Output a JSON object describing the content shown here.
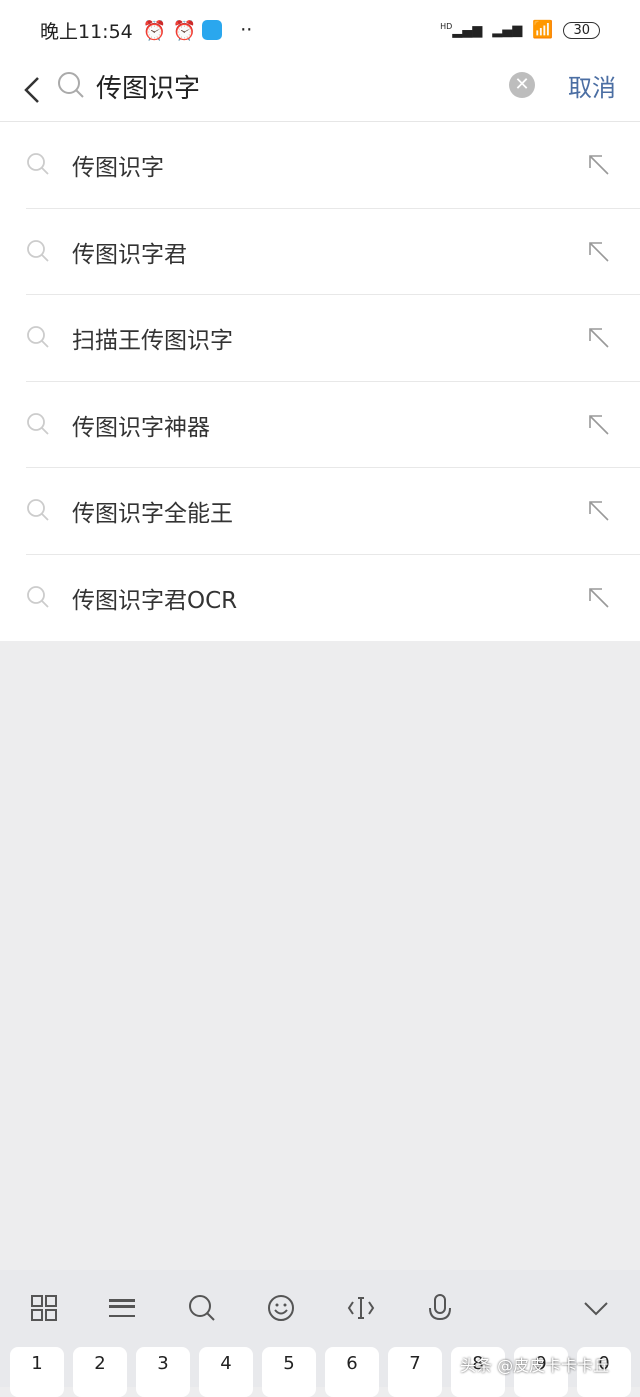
{
  "status": {
    "time": "晚上11:54",
    "battery": "30",
    "net": "HD"
  },
  "header": {
    "query": "传图识字",
    "cancel": "取消"
  },
  "suggestions": [
    "传图识字",
    "传图识字君",
    "扫描王传图识字",
    "传图识字神器",
    "传图识字全能王",
    "传图识字君OCR"
  ],
  "keyboard": {
    "toolbar": [
      "grid-icon",
      "keyboard-icon",
      "search-icon",
      "emoji-icon",
      "cursor-icon",
      "mic-icon",
      "collapse-icon"
    ],
    "keys": [
      "1",
      "2",
      "3",
      "4",
      "5",
      "6",
      "7",
      "8",
      "9",
      "0"
    ]
  },
  "watermark": "头条 @皮皮卡卡卡丘",
  "colors": {
    "accent": "#4b6ea3",
    "background": "#ededee"
  }
}
